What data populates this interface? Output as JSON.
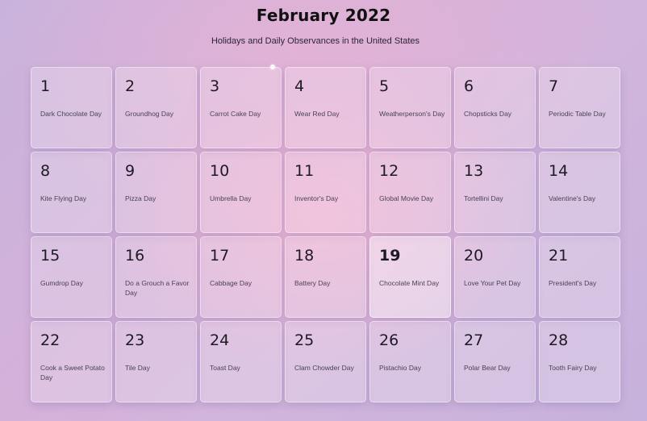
{
  "header": {
    "title": "February 2022",
    "subtitle": "Holidays and Daily Observances in the United States"
  },
  "calendar": {
    "highlighted_day": "19",
    "days": [
      {
        "day": "1",
        "observance": "Dark Chocolate Day"
      },
      {
        "day": "2",
        "observance": "Groundhog Day"
      },
      {
        "day": "3",
        "observance": "Carrot Cake Day"
      },
      {
        "day": "4",
        "observance": "Wear Red Day"
      },
      {
        "day": "5",
        "observance": "Weatherperson's Day"
      },
      {
        "day": "6",
        "observance": "Chopsticks Day"
      },
      {
        "day": "7",
        "observance": "Periodic Table Day"
      },
      {
        "day": "8",
        "observance": "Kite Flying Day"
      },
      {
        "day": "9",
        "observance": "Pizza Day"
      },
      {
        "day": "10",
        "observance": "Umbrella Day"
      },
      {
        "day": "11",
        "observance": "Inventor's Day"
      },
      {
        "day": "12",
        "observance": "Global Movie Day"
      },
      {
        "day": "13",
        "observance": "Tortellini Day"
      },
      {
        "day": "14",
        "observance": "Valentine's Day"
      },
      {
        "day": "15",
        "observance": "Gumdrop Day"
      },
      {
        "day": "16",
        "observance": "Do a Grouch a Favor Day"
      },
      {
        "day": "17",
        "observance": "Cabbage Day"
      },
      {
        "day": "18",
        "observance": "Battery Day"
      },
      {
        "day": "19",
        "observance": "Chocolate Mint Day"
      },
      {
        "day": "20",
        "observance": "Love Your Pet Day"
      },
      {
        "day": "21",
        "observance": "President's Day"
      },
      {
        "day": "22",
        "observance": "Cook a Sweet Potato Day"
      },
      {
        "day": "23",
        "observance": "Tile Day"
      },
      {
        "day": "24",
        "observance": "Toast Day"
      },
      {
        "day": "25",
        "observance": "Clam Chowder Day"
      },
      {
        "day": "26",
        "observance": "Pistachio Day"
      },
      {
        "day": "27",
        "observance": "Polar Bear Day"
      },
      {
        "day": "28",
        "observance": "Tooth Fairy Day"
      }
    ]
  }
}
